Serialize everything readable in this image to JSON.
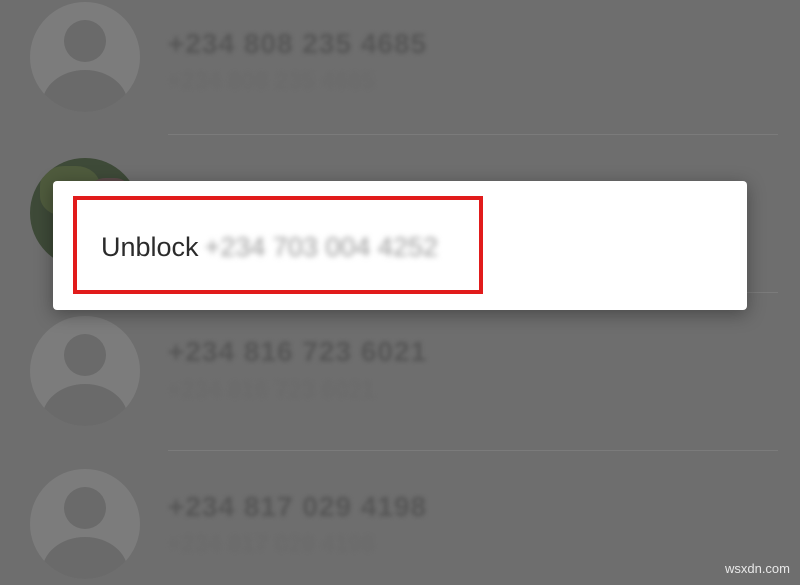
{
  "contacts": [
    {
      "name": "+234 808 235 4685",
      "subtitle": "+234 808 235 4685",
      "avatar": "person-icon"
    },
    {
      "name": "",
      "subtitle": "",
      "avatar": "photo"
    },
    {
      "name": "+234 816 723 6021",
      "subtitle": "+234 816 723 6021",
      "avatar": "person-icon"
    },
    {
      "name": "+234 817 029 4198",
      "subtitle": "+234 817 029 4198",
      "avatar": "person-icon"
    }
  ],
  "dialog": {
    "option_label": "Unblock",
    "option_number": "+234 703 004 4252"
  },
  "colors": {
    "highlight": "#e11b1b",
    "scrim": "#6e6e6e",
    "dialog_bg": "#ffffff"
  },
  "watermark": "wsxdn.com"
}
